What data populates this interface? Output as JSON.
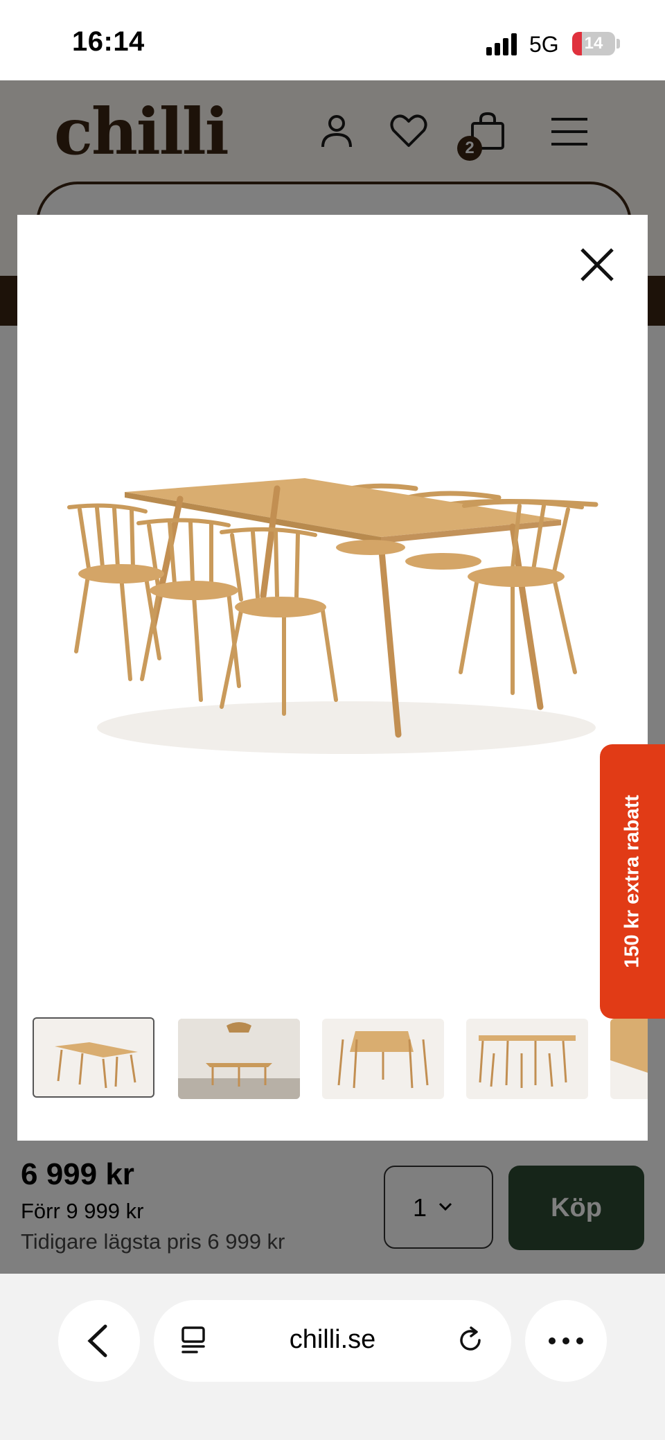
{
  "status_bar": {
    "time": "16:14",
    "network": "5G",
    "battery": "14"
  },
  "header": {
    "logo": "chilli",
    "cart_count": "2"
  },
  "product": {
    "price": "6 999 kr",
    "previous_price": "Förr 9 999 kr",
    "lowest_price": "Tidigare lägsta pris 6 999 kr",
    "quantity": "1",
    "buy_label": "Köp"
  },
  "promo": {
    "label": "150 kr extra rabatt"
  },
  "gallery": {
    "thumbnail_count": 5,
    "selected_index": 0
  },
  "browser": {
    "url": "chilli.se"
  },
  "colors": {
    "brand_brown": "#3a2412",
    "buy_green": "#2d4a33",
    "promo_red": "#e13b16",
    "wood": "#c99a5b"
  }
}
